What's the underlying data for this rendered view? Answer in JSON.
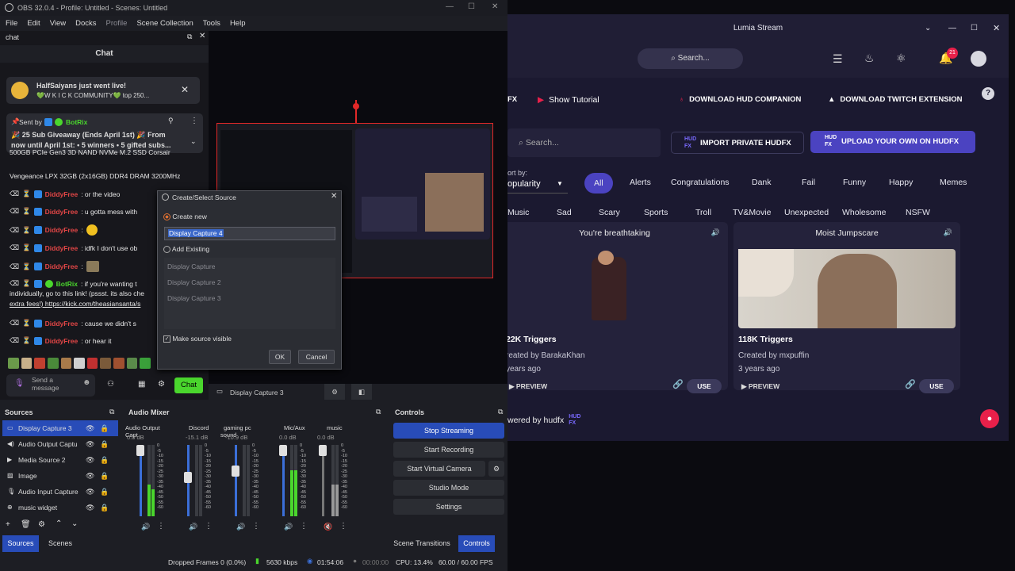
{
  "obs": {
    "title": "OBS 32.0.4 - Profile: Untitled - Scenes: Untitled",
    "menu": [
      "File",
      "Edit",
      "View",
      "Docks",
      "Profile",
      "Scene Collection",
      "Tools",
      "Help"
    ],
    "chat_dock_title": "chat",
    "chat_header": "Chat",
    "live_card": {
      "title": "HalfSaiyans just went live!",
      "sub": "💚W K I C K COMMUNITY💚 top 250..."
    },
    "pinned": {
      "sent_by": "Sent by",
      "user": "BotRix",
      "text1": "🎉 25 Sub Giveaway (Ends April 1st) 🎉 From",
      "text2": "now until April 1st: • 5 winners • 5 gifted subs..."
    },
    "chat_lines": [
      {
        "text": "500GB PCIe Gen3 3D NAND NVMe M.2 SSD Corsair"
      },
      {
        "text": "Vengeance LPX 32GB (2x16GB) DDR4 DRAM 3200MHz"
      },
      {
        "user": "DiddyFree",
        "msg": ": or the video"
      },
      {
        "user": "DiddyFree",
        "msg": ": u gotta mess with"
      },
      {
        "user": "DiddyFree",
        "msg": ":"
      },
      {
        "user": "DiddyFree",
        "msg": ": idfk I don't use ob"
      },
      {
        "user": "DiddyFree",
        "msg": ":"
      },
      {
        "user": "BotRix",
        "msg": ": if you're wanting t"
      },
      {
        "text": "individually, go to this link! (pssst. its also che"
      },
      {
        "text": "extra fees!) https://kick.com/theasiansanta/s"
      },
      {
        "user": "DiddyFree",
        "msg": ": cause we didn't s"
      },
      {
        "user": "DiddyFree",
        "msg": ": or hear it"
      }
    ],
    "send_placeholder": "Send a message",
    "chat_button": "Chat",
    "dialog": {
      "title": "Create/Select Source",
      "create_new": "Create new",
      "name_value": "Display Capture 4",
      "add_existing": "Add Existing",
      "existing": [
        "Display Capture",
        "Display Capture 2",
        "Display Capture 3"
      ],
      "make_visible": "Make source visible",
      "ok": "OK",
      "cancel": "Cancel"
    },
    "source_bar_label": "Display Capture 3",
    "sources_title": "Sources",
    "sources": [
      {
        "name": "Display Capture 3",
        "icon": "monitor-icon"
      },
      {
        "name": "Audio Output Captu",
        "icon": "speaker-icon"
      },
      {
        "name": "Media Source 2",
        "icon": "play-icon"
      },
      {
        "name": "Image",
        "icon": "image-icon"
      },
      {
        "name": "Audio Input Capture",
        "icon": "mic-icon"
      },
      {
        "name": "music widget",
        "icon": "globe-icon"
      }
    ],
    "mixer_title": "Audio Mixer",
    "mixer": [
      {
        "name": "Audio Output Capt",
        "db": "0.0 dB"
      },
      {
        "name": "Discord",
        "db": "-15.1 dB"
      },
      {
        "name": "gaming pc sound",
        "db": "-10.9 dB"
      },
      {
        "name": "Mic/Aux",
        "db": "0.0 dB"
      },
      {
        "name": "music",
        "db": "0.0 dB"
      }
    ],
    "mixer_scale": [
      "0",
      "-5",
      "-10",
      "-15",
      "-20",
      "-25",
      "-30",
      "-35",
      "-40",
      "-45",
      "-50",
      "-55",
      "-60"
    ],
    "controls_title": "Controls",
    "controls": [
      "Stop Streaming",
      "Start Recording",
      "Start Virtual Camera",
      "Studio Mode",
      "Settings"
    ],
    "tabs_left": [
      "Sources",
      "Scenes"
    ],
    "tabs_right": [
      "Scene Transitions",
      "Controls"
    ],
    "status": {
      "dropped": "Dropped Frames 0 (0.0%)",
      "kbps": "5630 kbps",
      "stream_time": "01:54:06",
      "rec_time": "00:00:00",
      "cpu": "CPU: 13.4%",
      "fps": "60.00 / 60.00 FPS"
    },
    "colors": {
      "accent": "#284cb8",
      "chat_green": "#4ad62d",
      "username_red": "#e24646",
      "selection_red": "#e12828"
    }
  },
  "lumia": {
    "title": "Lumia Stream",
    "search_placeholder": "Search...",
    "notification_count": "21",
    "show_tutorial": "Show Tutorial",
    "tab_fragment": "FX",
    "download_hud": "DOWNLOAD HUD COMPANION",
    "download_twitch": "DOWNLOAD TWITCH EXTENSION",
    "search2_placeholder": "Search...",
    "import_private": "IMPORT PRIVATE HUDFX",
    "upload_own": "UPLOAD YOUR OWN ON HUDFX",
    "sort_by": "ort by:",
    "sort_value": "opularity",
    "chips_row1": [
      "All",
      "Alerts",
      "Congratulations",
      "Dank",
      "Fail",
      "Funny",
      "Happy",
      "Memes"
    ],
    "chips_row2": [
      "Music",
      "Sad",
      "Scary",
      "Sports",
      "Troll",
      "TV&Movie",
      "Unexpected",
      "Wholesome",
      "NSFW"
    ],
    "cards": [
      {
        "title": "You're breathtaking",
        "triggers": "22K Triggers",
        "creator": "reated by BarakaKhan",
        "age": "years ago",
        "preview": "PREVIEW",
        "use": "USE"
      },
      {
        "title": "Moist Jumpscare",
        "triggers": "118K Triggers",
        "creator": "Created by mxpuffin",
        "age": "3 years ago",
        "preview": "PREVIEW",
        "use": "USE"
      }
    ],
    "powered": "wered by hudfx",
    "colors": {
      "bg": "#1b1930",
      "accent": "#4b43c1",
      "badge_red": "#e8204a"
    }
  }
}
